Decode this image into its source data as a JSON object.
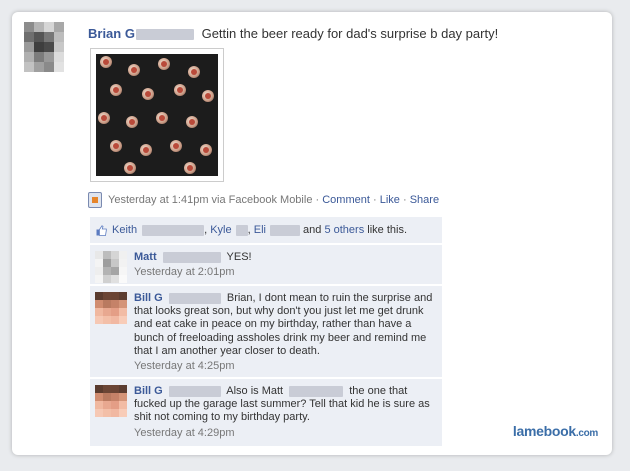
{
  "post": {
    "author_first": "Brian G",
    "status_text": "Gettin the beer ready for dad's surprise b day party!",
    "time": "Yesterday at 1:41pm via Facebook Mobile",
    "sep1": "·",
    "comment_link": "Comment",
    "sep2": "·",
    "like_link": "Like",
    "sep3": "·",
    "share_link": "Share"
  },
  "likes": {
    "name1": "Keith",
    "sep_a": ",",
    "name2": "Kyle",
    "sep_b": ",",
    "name3": "Eli",
    "and_text": "and",
    "others_link": "5 others",
    "suffix": "like this."
  },
  "comments": [
    {
      "author": "Matt",
      "text": "YES!",
      "time": "Yesterday at 2:01pm"
    },
    {
      "author": "Bill G",
      "text": "Brian, I dont mean to ruin the surprise and that looks great son, but why don't you just let me get drunk and eat cake in peace on my birthday, rather than have a bunch of freeloading assholes drink my beer and remind me that I am another year closer to death.",
      "time": "Yesterday at 4:25pm"
    },
    {
      "author": "Bill G",
      "text_a": "Also is Matt",
      "text_b": "the one that fucked up the garage last summer? Tell that kid he is sure as shit not coming to my birthday party.",
      "time": "Yesterday at 4:29pm"
    }
  ],
  "watermark": {
    "main": "lamebook",
    "suffix": ".com"
  },
  "colors": {
    "link": "#3b5998",
    "panel": "#eceff5",
    "meta_text": "#777777"
  },
  "icons": [
    "thumbs-up-icon",
    "mobile-upload-icon"
  ]
}
